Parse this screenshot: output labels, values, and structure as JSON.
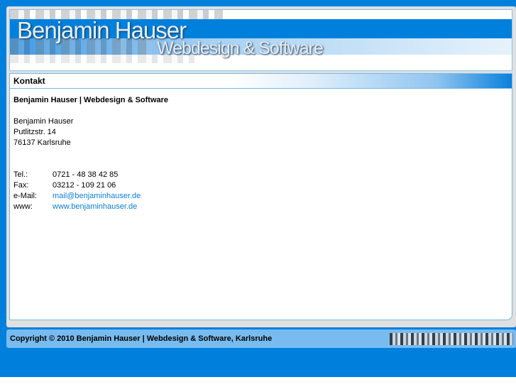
{
  "header": {
    "name": "Benjamin Hauser",
    "subtitle": "Webdesign & Software"
  },
  "content": {
    "title": "Kontakt",
    "company_line": "Benjamin Hauser |  Webdesign & Software",
    "address": [
      "Benjamin Hauser",
      "Putlitzstr. 14",
      "76137 Karlsruhe"
    ],
    "contacts": [
      {
        "label": "Tel.:",
        "value": "0721 - 48 38 42 85"
      },
      {
        "label": "Fax:",
        "value": "03212 - 109 21 06"
      },
      {
        "label": "e-Mail:",
        "value": "mail@benjaminhauser.de"
      },
      {
        "label": "www:",
        "value": "www.benjaminhauser.de"
      }
    ]
  },
  "footer": {
    "copyright": "Copyright © 2010 Benjamin Hauser |  Webdesign & Software, Karlsruhe"
  }
}
